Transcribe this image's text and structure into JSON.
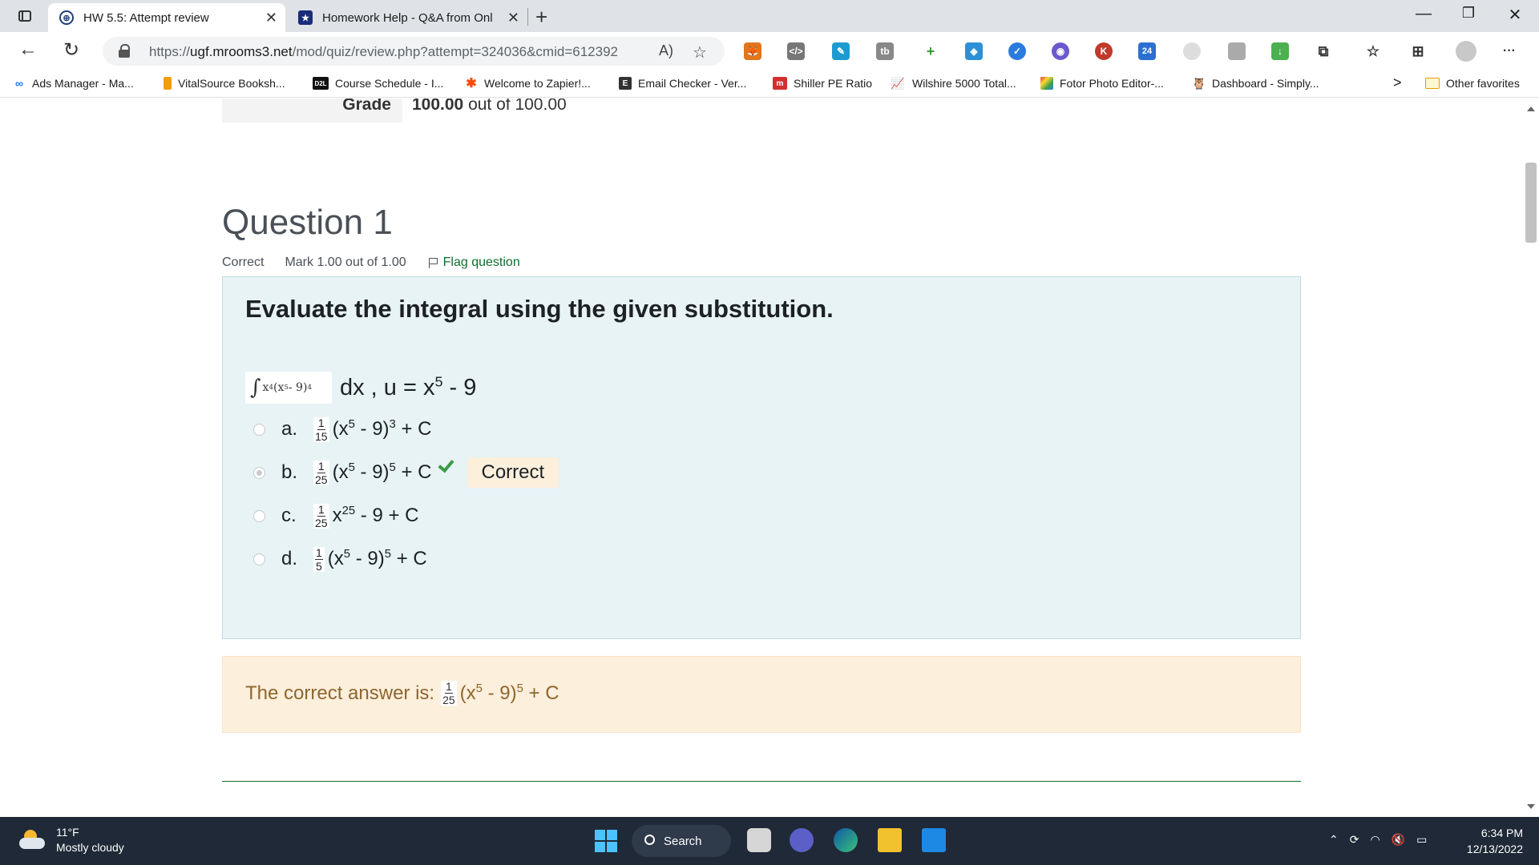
{
  "browser": {
    "tabs": [
      {
        "title": "HW 5.5: Attempt review",
        "active": true
      },
      {
        "title": "Homework Help - Q&A from Onl",
        "active": false
      }
    ],
    "new_tab": "+",
    "window_controls": {
      "minimize": "—",
      "restore": "❐",
      "close": "✕"
    },
    "url": {
      "prefix": "https://",
      "host": "ugf.mrooms3.net",
      "path": "/mod/quiz/review.php?attempt=324036&cmid=612392"
    },
    "read_aloud": "A)",
    "extension_badge": "24",
    "menu": "···"
  },
  "favorites": [
    {
      "label": "Ads Manager - Ma...",
      "icon": "meta-icon"
    },
    {
      "label": "VitalSource Booksh...",
      "icon": "vitalsource-icon"
    },
    {
      "label": "Course Schedule - I...",
      "icon": "d2l-icon",
      "icon_text": "D2L"
    },
    {
      "label": "Welcome to Zapier!...",
      "icon": "zapier-icon"
    },
    {
      "label": "Email Checker - Ver...",
      "icon": "email-checker-icon",
      "icon_text": "E"
    },
    {
      "label": "Shiller PE Ratio",
      "icon": "multpl-icon",
      "icon_text": "m"
    },
    {
      "label": "Wilshire 5000 Total...",
      "icon": "chart-icon"
    },
    {
      "label": "Fotor Photo Editor-...",
      "icon": "fotor-icon"
    },
    {
      "label": "Dashboard - Simply...",
      "icon": "simply-icon"
    }
  ],
  "favorites_more": ">",
  "other_favorites": "Other favorites",
  "grade": {
    "label": "Grade",
    "value_bold": "100.00",
    "value_rest": " out of 100.00"
  },
  "question": {
    "title": "Question 1",
    "state": "Correct",
    "mark": "Mark 1.00 out of 1.00",
    "flag": "Flag question",
    "prompt": "Evaluate the integral using the given substitution.",
    "integral_image": {
      "sym": "∫",
      "base1": "x",
      "exp1": "4",
      "base2": "(x",
      "exp2": "5",
      "rest": " - 9)",
      "exp3": "4"
    },
    "substitution": {
      "a": "dx , u = x",
      "exp": "5",
      "b": " - 9"
    },
    "answers": [
      {
        "letter": "a.",
        "num": "1",
        "den": "15",
        "base": "(x",
        "exp1": "5",
        "mid": " - 9)",
        "exp2": "3",
        "tail": " + C",
        "selected": false
      },
      {
        "letter": "b.",
        "num": "1",
        "den": "25",
        "base": "(x",
        "exp1": "5",
        "mid": " - 9)",
        "exp2": "5",
        "tail": " + C",
        "selected": true
      },
      {
        "letter": "c.",
        "num": "1",
        "den": "25",
        "base": "x",
        "exp1": "25",
        "mid": " - 9 + C",
        "exp2": "",
        "tail": "",
        "selected": false
      },
      {
        "letter": "d.",
        "num": "1",
        "den": "5",
        "base": "(x",
        "exp1": "5",
        "mid": " - 9)",
        "exp2": "5",
        "tail": " + C",
        "selected": false
      }
    ],
    "correct_badge": "Correct",
    "feedback": {
      "label": "The correct answer is:",
      "num": "1",
      "den": "25",
      "base": "(x",
      "exp1": "5",
      "mid": " - 9)",
      "exp2": "5",
      "tail": " + C"
    }
  },
  "taskbar": {
    "weather_temp": "11°F",
    "weather_desc": "Mostly cloudy",
    "search": "Search",
    "time": "6:34 PM",
    "date": "12/13/2022"
  },
  "colors": {
    "accent": "#0f6e2f",
    "correct_bg": "#fcefdc",
    "question_bg": "#e7f3f5",
    "taskbar": "#1f2937"
  }
}
